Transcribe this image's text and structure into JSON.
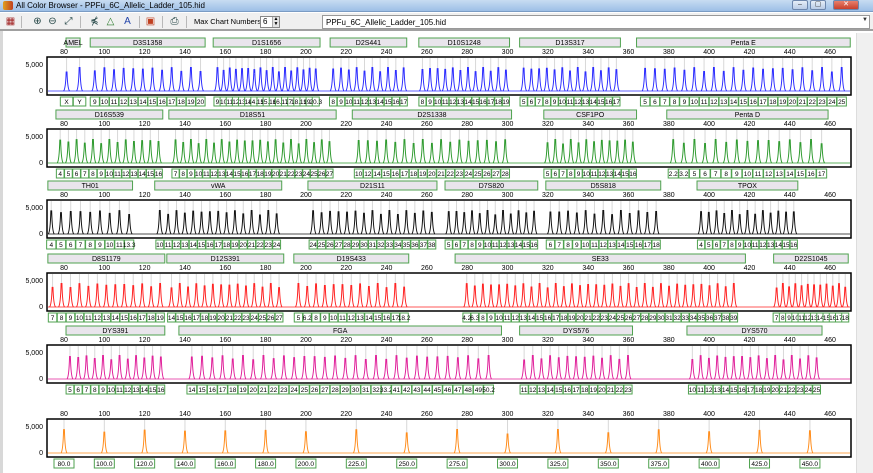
{
  "window": {
    "title": "All Color Browser - PPFu_6C_Allelic_Ladder_105.hid",
    "minimize": "–",
    "maximize": "▢",
    "close": "✕"
  },
  "toolbar": {
    "icons": [
      "color-grid-icon",
      "zoom-in-icon",
      "zoom-out-icon",
      "zoom-fit-icon",
      "peak-cut-icon",
      "triangle-label-icon",
      "allele-label-icon",
      "panel-icon",
      "print-icon"
    ],
    "max_chart_label": "Max Chart Numbers:",
    "max_chart_value": "6",
    "file_select": "PPFu_6C_Allelic_Ladder_105.hid"
  },
  "chart_data": {
    "type": "line",
    "x_ticks": [
      "80",
      "100",
      "120",
      "140",
      "160",
      "180",
      "200",
      "220",
      "240",
      "260",
      "280",
      "300",
      "320",
      "340",
      "360",
      "380",
      "400",
      "420",
      "440",
      "460"
    ],
    "xlim": [
      71.6,
      470.4
    ],
    "y_ticks": [
      "5,000",
      "0"
    ],
    "panels": [
      {
        "color": "#2b2bff",
        "markers": [
          {
            "name": "AMEL",
            "range": [
              81,
              88
            ],
            "alleles": [
              "X",
              "Y"
            ]
          },
          {
            "name": "D3S1358",
            "range": [
              93,
              150
            ],
            "alleles": [
              "9",
              "10",
              "11",
              "12",
              "13",
              "14",
              "15",
              "16",
              "17",
              "18",
              "19",
              "20"
            ]
          },
          {
            "name": "D1S1656",
            "range": [
              154,
              207
            ],
            "alleles": [
              "9",
              "10",
              "11",
              "12",
              "13",
              "14",
              "14.3",
              "15",
              "15.3",
              "16",
              "16.3",
              "17",
              "17.3",
              "18.3",
              "19",
              "19.3",
              "20.3"
            ]
          },
          {
            "name": "D2S441",
            "range": [
              212,
              250
            ],
            "alleles": [
              "8",
              "9",
              "10",
              "11",
              "12",
              "13",
              "14",
              "15",
              "16",
              "17"
            ]
          },
          {
            "name": "D10S1248",
            "range": [
              256,
              301
            ],
            "alleles": [
              "8",
              "9",
              "10",
              "11",
              "12",
              "13",
              "14",
              "15",
              "16",
              "17",
              "18",
              "19"
            ]
          },
          {
            "name": "D13S317",
            "range": [
              306,
              356
            ],
            "alleles": [
              "5",
              "6",
              "7",
              "8",
              "9",
              "10",
              "11",
              "12",
              "13",
              "14",
              "15",
              "16",
              "17"
            ]
          },
          {
            "name": "Penta E",
            "range": [
              364,
              470
            ],
            "alleles": [
              "5",
              "6",
              "7",
              "8",
              "9",
              "10",
              "11",
              "12",
              "13",
              "14",
              "15",
              "16",
              "17",
              "18",
              "19",
              "20",
              "21",
              "22",
              "23",
              "24",
              "25"
            ]
          }
        ]
      },
      {
        "color": "#2e9a2e",
        "markers": [
          {
            "name": "D16S539",
            "range": [
              76,
              129
            ],
            "alleles": [
              "4",
              "5",
              "6",
              "7",
              "8",
              "9",
              "10",
              "11",
              "12",
              "13",
              "14",
              "15",
              "16"
            ]
          },
          {
            "name": "D18S51",
            "range": [
              132,
              215
            ],
            "alleles": [
              "7",
              "8",
              "9",
              "10",
              "11",
              "12",
              "13",
              "14",
              "15",
              "16",
              "17",
              "18",
              "19",
              "20",
              "21",
              "22",
              "23",
              "24",
              "25",
              "26",
              "27"
            ]
          },
          {
            "name": "D2S1338",
            "range": [
              223,
              302
            ],
            "alleles": [
              "10",
              "12",
              "14",
              "15",
              "16",
              "17",
              "18",
              "19",
              "20",
              "21",
              "22",
              "23",
              "24",
              "25",
              "26",
              "27",
              "28"
            ]
          },
          {
            "name": "CSF1PO",
            "range": [
              318,
              364
            ],
            "alleles": [
              "5",
              "6",
              "7",
              "8",
              "9",
              "10",
              "11",
              "12",
              "13",
              "14",
              "15",
              "16"
            ]
          },
          {
            "name": "Penta D",
            "range": [
              379,
              459
            ],
            "alleles": [
              "2.2",
              "3.2",
              "5",
              "6",
              "7",
              "8",
              "9",
              "10",
              "11",
              "12",
              "13",
              "14",
              "15",
              "16",
              "17"
            ]
          }
        ]
      },
      {
        "color": "#111111",
        "markers": [
          {
            "name": "TH01",
            "range": [
              72,
              114
            ],
            "alleles": [
              "4",
              "5",
              "6",
              "7",
              "8",
              "9",
              "10",
              "11",
              "13.3"
            ]
          },
          {
            "name": "vWA",
            "range": [
              125,
              188
            ],
            "alleles": [
              "10",
              "11",
              "12",
              "13",
              "14",
              "15",
              "16",
              "17",
              "18",
              "19",
              "20",
              "21",
              "22",
              "23",
              "24"
            ]
          },
          {
            "name": "D21S11",
            "range": [
              201,
              265
            ],
            "alleles": [
              "24",
              "25",
              "26",
              "27",
              "28",
              "29",
              "30",
              "31",
              "32",
              "33",
              "34",
              "35",
              "36",
              "37",
              "38"
            ]
          },
          {
            "name": "D7S820",
            "range": [
              269,
              315
            ],
            "alleles": [
              "5",
              "6",
              "7",
              "8",
              "9",
              "10",
              "11",
              "12",
              "13",
              "14",
              "15",
              "16"
            ]
          },
          {
            "name": "D5S818",
            "range": [
              319,
              376
            ],
            "alleles": [
              "6",
              "7",
              "8",
              "9",
              "10",
              "11",
              "12",
              "13",
              "14",
              "15",
              "16",
              "17",
              "18"
            ]
          },
          {
            "name": "TPOX",
            "range": [
              394,
              444
            ],
            "alleles": [
              "4",
              "5",
              "6",
              "7",
              "8",
              "9",
              "10",
              "11",
              "12",
              "13",
              "14",
              "15",
              "16"
            ]
          }
        ]
      },
      {
        "color": "#ff2222",
        "markers": [
          {
            "name": "D8S1179",
            "range": [
              72,
              130
            ],
            "alleles": [
              "7",
              "8",
              "9",
              "10",
              "11",
              "12",
              "13",
              "14",
              "15",
              "16",
              "17",
              "18",
              "19"
            ]
          },
          {
            "name": "D12S391",
            "range": [
              131,
              189
            ],
            "alleles": [
              "14",
              "15",
              "16",
              "17",
              "18",
              "19",
              "20",
              "21",
              "22",
              "23",
              "24",
              "25",
              "26",
              "27"
            ]
          },
          {
            "name": "D19S433",
            "range": [
              194,
              251
            ],
            "alleles": [
              "5",
              "6.2",
              "8",
              "9",
              "10",
              "11",
              "12",
              "13",
              "14",
              "15",
              "16",
              "17",
              "18.2"
            ]
          },
          {
            "name": "SE33",
            "range": [
              274,
              418
            ],
            "alleles": [
              "4.2",
              "6.3",
              "8",
              "9",
              "10",
              "11",
              "12",
              "13",
              "14",
              "15",
              "16",
              "17",
              "18",
              "19",
              "20",
              "21",
              "22",
              "23",
              "24",
              "25",
              "26",
              "27",
              "28",
              "29",
              "30",
              "31",
              "32",
              "33",
              "34",
              "35",
              "36",
              "37",
              "38",
              "39"
            ]
          },
          {
            "name": "D22S1045",
            "range": [
              432,
              469
            ],
            "alleles": [
              "7",
              "8",
              "9",
              "10",
              "11",
              "12",
              "13",
              "14",
              "15",
              "16",
              "17",
              "18"
            ]
          }
        ]
      },
      {
        "color": "#e0209a",
        "markers": [
          {
            "name": "DYS391",
            "range": [
              81,
              130
            ],
            "alleles": [
              "5",
              "6",
              "7",
              "8",
              "9",
              "10",
              "11",
              "12",
              "13",
              "14",
              "15",
              "16"
            ]
          },
          {
            "name": "FGA",
            "range": [
              137,
              297
            ],
            "alleles": [
              "14",
              "15",
              "16",
              "17",
              "18",
              "19",
              "20",
              "21",
              "22",
              "23",
              "24",
              "25",
              "26",
              "27",
              "28",
              "29",
              "30",
              "31",
              "32",
              "33.2",
              "41",
              "42",
              "43",
              "44",
              "45",
              "46",
              "47",
              "48",
              "49",
              "50.2"
            ]
          },
          {
            "name": "DYS576",
            "range": [
              306,
              362
            ],
            "alleles": [
              "11",
              "12",
              "13",
              "14",
              "15",
              "16",
              "17",
              "18",
              "19",
              "20",
              "21",
              "22",
              "23"
            ]
          },
          {
            "name": "DYS570",
            "range": [
              389,
              456
            ],
            "alleles": [
              "10",
              "11",
              "12",
              "13",
              "14",
              "15",
              "16",
              "17",
              "18",
              "19",
              "20",
              "21",
              "22",
              "23",
              "24",
              "25"
            ]
          }
        ]
      },
      {
        "color": "#ff8c1a",
        "markers": [],
        "size_standard": [
          "80.0",
          "100.0",
          "120.0",
          "140.0",
          "160.0",
          "180.0",
          "200.0",
          "225.0",
          "250.0",
          "275.0",
          "300.0",
          "325.0",
          "350.0",
          "375.0",
          "400.0",
          "425.0",
          "450.0"
        ]
      }
    ]
  }
}
